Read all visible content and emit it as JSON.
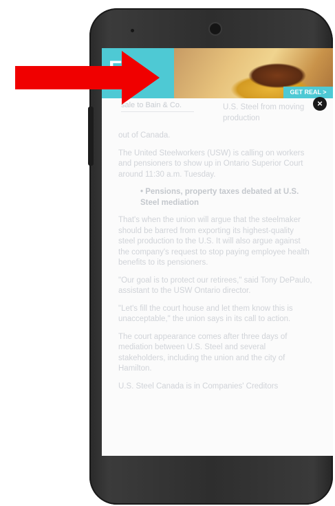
{
  "ad": {
    "logo_text": "E",
    "logo_sub": "",
    "cta_label": "GET REAL >",
    "close_label": "×"
  },
  "article": {
    "intro_left": "sale to Bain & Co.",
    "intro_right": "U.S. Steel from moving production",
    "intro_tail": "out of Canada.",
    "paragraphs": [
      "The United Steelworkers (USW) is calling on workers and pensioners to show up in Ontario Superior Court around 11:30 a.m. Tuesday.",
      "That's when the union will argue that the steelmaker should be barred from exporting its highest-quality steel production to the U.S. It will also argue against the company's request to stop paying employee health benefits to its pensioners.",
      "\"Our goal is to protect our retirees,\" said Tony DePaulo, assistant to the USW Ontario director.",
      "\"Let's fill the court house and let them know this is unacceptable,\" the union says in its call to action.",
      "The court appearance comes after three days of mediation between U.S. Steel and several stakeholders, including the union and the city of Hamilton.",
      "U.S. Steel Canada is in Companies' Creditors"
    ],
    "bullet": "Pensions, property taxes debated at U.S. Steel mediation"
  },
  "colors": {
    "arrow": "#f00000",
    "ad_bg": "#4ec9d4",
    "phone": "#2e2e2e",
    "text": "#d0d3d8"
  },
  "icons": {
    "close": "close-icon",
    "arrow": "red-arrow-icon"
  }
}
